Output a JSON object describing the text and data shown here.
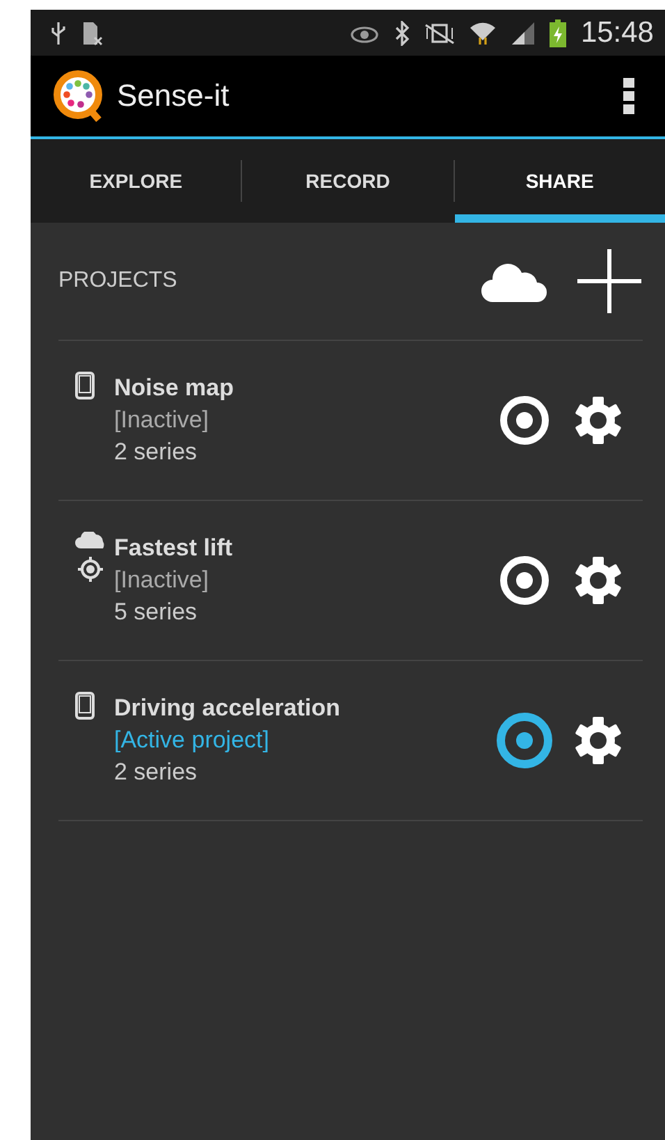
{
  "status_bar": {
    "time": "15:48"
  },
  "action_bar": {
    "title": "Sense-it"
  },
  "tabs": [
    {
      "label": "EXPLORE",
      "selected": false
    },
    {
      "label": "RECORD",
      "selected": false
    },
    {
      "label": "SHARE",
      "selected": true
    }
  ],
  "section": {
    "title": "PROJECTS"
  },
  "projects": [
    {
      "kind": "device",
      "name": "Noise map",
      "status": "[Inactive]",
      "series": "2 series",
      "selected": false
    },
    {
      "kind": "cloud",
      "name": "Fastest lift",
      "status": "[Inactive]",
      "series": "5 series",
      "selected": false
    },
    {
      "kind": "device",
      "name": "Driving acceleration",
      "status": "[Active project]",
      "series": "2 series",
      "selected": true
    }
  ]
}
